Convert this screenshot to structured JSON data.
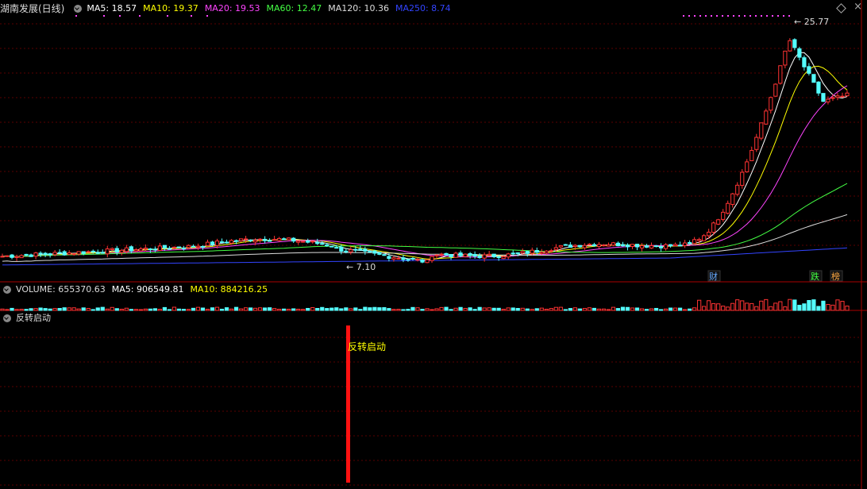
{
  "header": {
    "stock_name": "湖南发展(日线)",
    "ma": [
      {
        "label": "MA5: 18.57",
        "color": "#ffffff"
      },
      {
        "label": "MA10: 19.37",
        "color": "#ffff00"
      },
      {
        "label": "MA20: 19.53",
        "color": "#ff44ff"
      },
      {
        "label": "MA60: 12.47",
        "color": "#44ff44"
      },
      {
        "label": "MA120: 10.36",
        "color": "#dddddd"
      },
      {
        "label": "MA250: 8.74",
        "color": "#3344ff"
      }
    ]
  },
  "volume_header": {
    "volume": "VOLUME: 655370.63",
    "ma5": "MA5: 906549.81",
    "ma10": "MA10: 884216.25"
  },
  "indicator_header": {
    "name": "反转启动"
  },
  "chart_data": {
    "type": "candlestick",
    "high_label": "25.77",
    "low_label": "7.10",
    "markers": [
      "财",
      "跌",
      "榜"
    ],
    "indicator_text": "反转启动",
    "price_axis": [
      6.5,
      27
    ]
  }
}
